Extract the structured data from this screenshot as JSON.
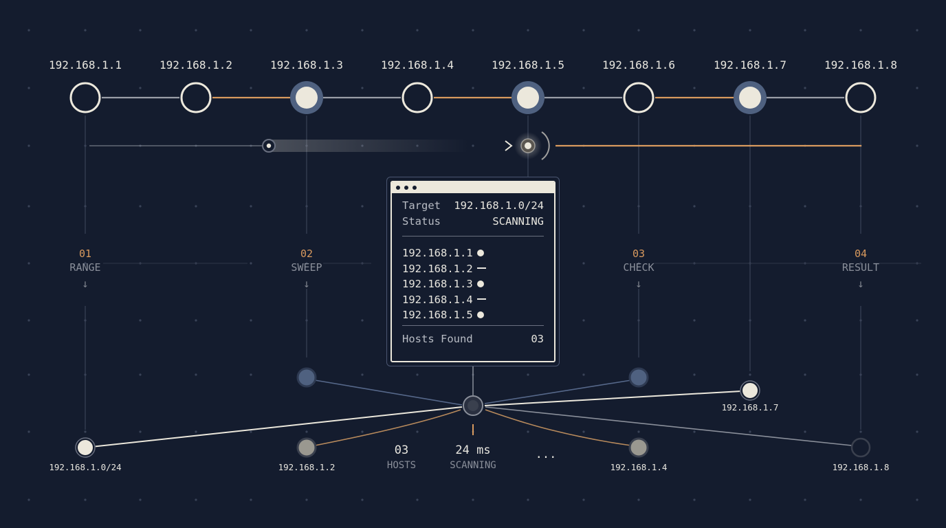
{
  "top_nodes": [
    {
      "ip": "192.168.1.1",
      "filled": false
    },
    {
      "ip": "192.168.1.2",
      "filled": false
    },
    {
      "ip": "192.168.1.3",
      "filled": true
    },
    {
      "ip": "192.168.1.4",
      "filled": false
    },
    {
      "ip": "192.168.1.5",
      "filled": true
    },
    {
      "ip": "192.168.1.6",
      "filled": false
    },
    {
      "ip": "192.168.1.7",
      "filled": true
    },
    {
      "ip": "192.168.1.8",
      "filled": false
    }
  ],
  "steps": [
    {
      "num": "01",
      "name": "RANGE",
      "arrow": "↓"
    },
    {
      "num": "02",
      "name": "SWEEP",
      "arrow": "↓"
    },
    {
      "num": "03",
      "name": "CHECK",
      "arrow": "↓"
    },
    {
      "num": "04",
      "name": "RESULT",
      "arrow": "↓"
    }
  ],
  "panel": {
    "target_key": "Target",
    "target_value": "192.168.1.0/24",
    "status_key": "Status",
    "status_value": "SCANNING",
    "hosts": [
      {
        "ip": "192.168.1.1",
        "state": "up"
      },
      {
        "ip": "192.168.1.2",
        "state": "down"
      },
      {
        "ip": "192.168.1.3",
        "state": "up"
      },
      {
        "ip": "192.168.1.4",
        "state": "down"
      },
      {
        "ip": "192.168.1.5",
        "state": "up"
      }
    ],
    "found_key": "Hosts Found",
    "found_value": "03"
  },
  "bottom_labels": {
    "range": "192.168.1.0/24",
    "host2": "192.168.1.2",
    "host4": "192.168.1.4",
    "host7": "192.168.1.7",
    "host8": "192.168.1.8"
  },
  "stats": {
    "hosts_value": "03",
    "hosts_label": "HOSTS",
    "latency_value": "24 ms",
    "latency_label": "SCANNING",
    "more": "..."
  },
  "colors": {
    "background": "#141c2e",
    "light": "#ece8dc",
    "accent": "#d99a5e",
    "blue_node": "#4f6180",
    "grey_line": "#8a8f9a"
  }
}
